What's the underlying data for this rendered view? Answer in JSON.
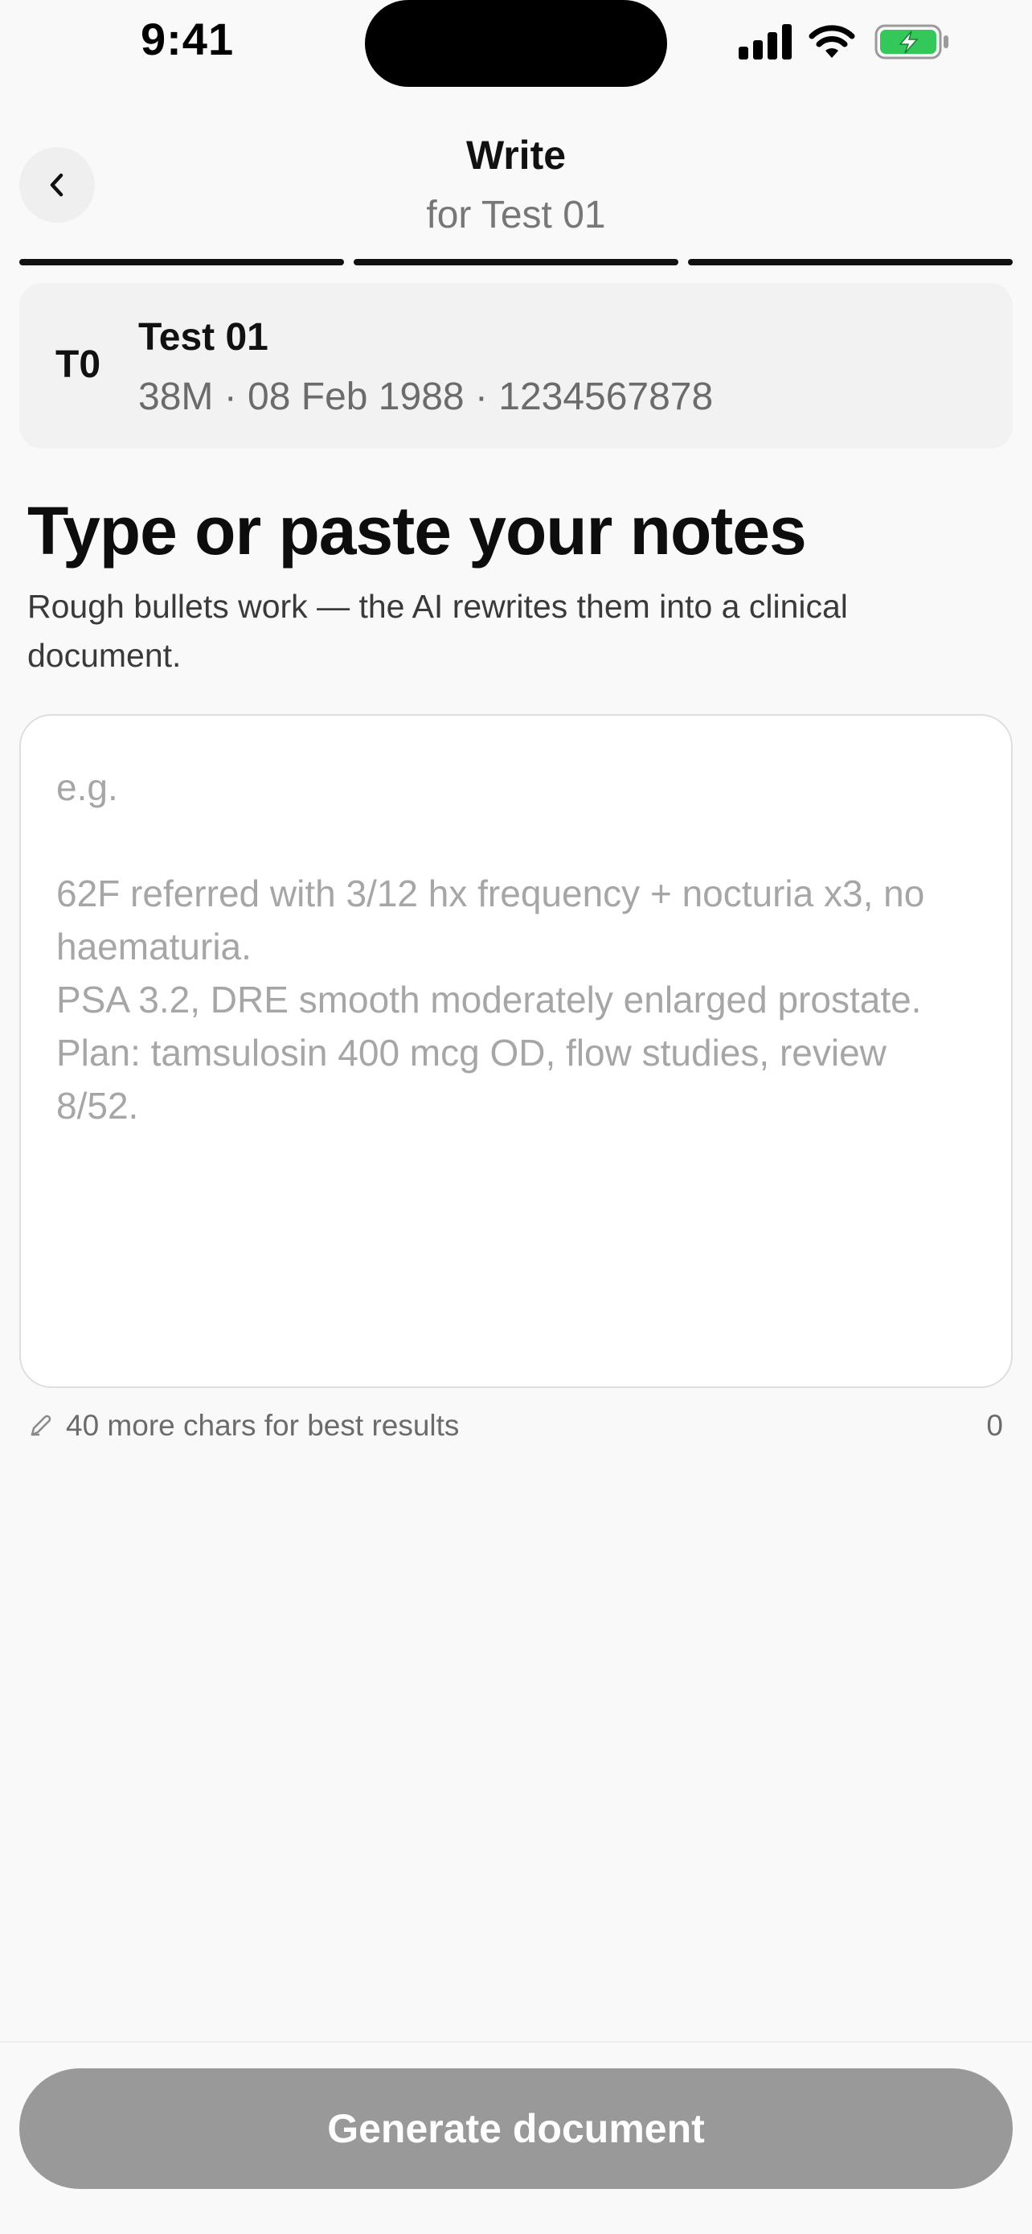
{
  "status_bar": {
    "time": "9:41"
  },
  "header": {
    "title": "Write",
    "subtitle": "for Test 01",
    "progress_steps": 3
  },
  "patient": {
    "initials": "T0",
    "name": "Test 01",
    "meta": "38M · 08 Feb 1988 · 1234567878"
  },
  "notes_section": {
    "heading": "Type or paste your notes",
    "description": "Rough bullets work — the AI rewrites them into a clinical document.",
    "value": "",
    "placeholder": "e.g.\n\n62F referred with 3/12 hx frequency + nocturia x3, no haematuria.\nPSA 3.2, DRE smooth moderately enlarged prostate.\nPlan: tamsulosin 400 mcg OD, flow studies, review 8/52.",
    "hint": "40 more chars for best results",
    "char_count": "0"
  },
  "footer": {
    "generate_label": "Generate document"
  },
  "colors": {
    "background": "#f9f9f9",
    "button_disabled": "#999999",
    "battery_green": "#34c759"
  },
  "icons": [
    "back-chevron-icon",
    "signal-icon",
    "wifi-icon",
    "battery-charging-icon",
    "pencil-icon"
  ]
}
